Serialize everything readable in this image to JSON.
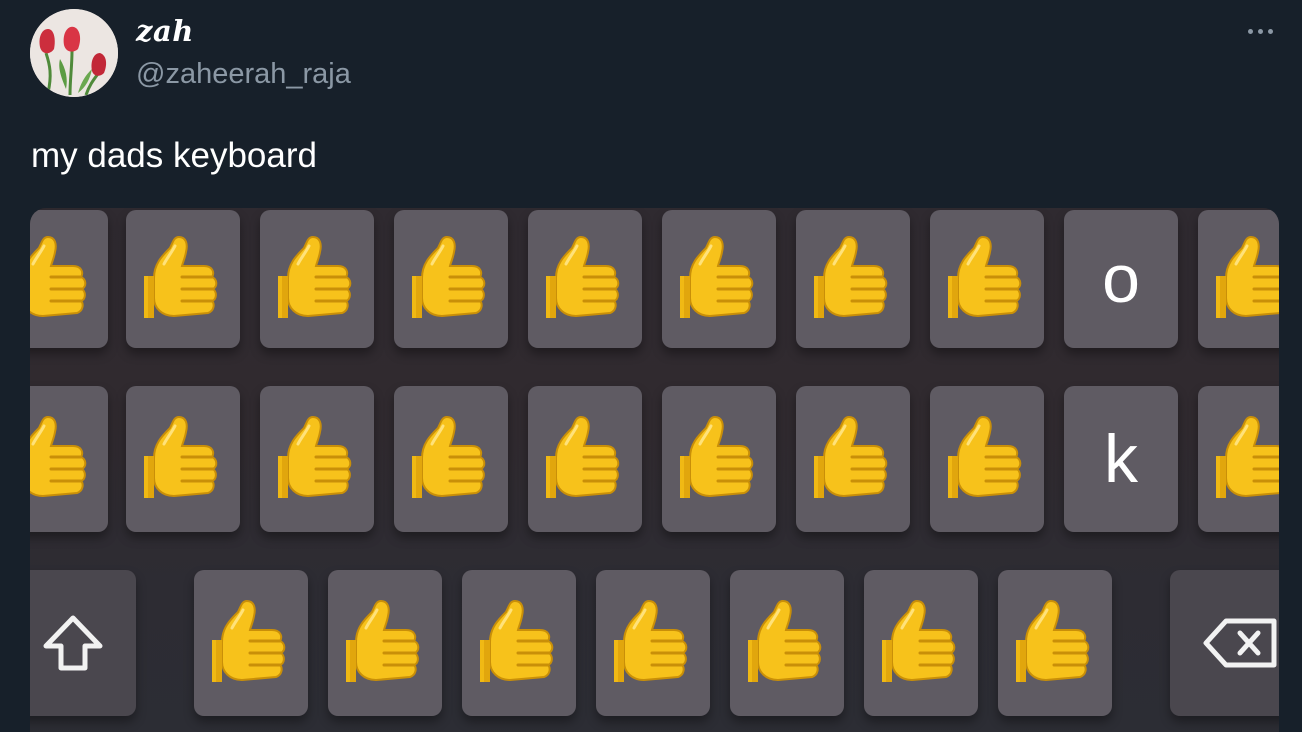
{
  "author": {
    "display_name": "zah",
    "handle": "@zaheerah_raja"
  },
  "tweet": {
    "text": "my dads keyboard"
  },
  "icons": {
    "more": "more-options-icon",
    "thumbs_up": "thumbs-up-emoji",
    "shift": "shift-arrow-icon",
    "backspace": "backspace-icon"
  },
  "keyboard": {
    "row1_letter": "o",
    "row2_letter": "k"
  },
  "colors": {
    "background": "#17202a",
    "key": "#5f5b63",
    "emoji_yellow": "#f7c21b"
  }
}
